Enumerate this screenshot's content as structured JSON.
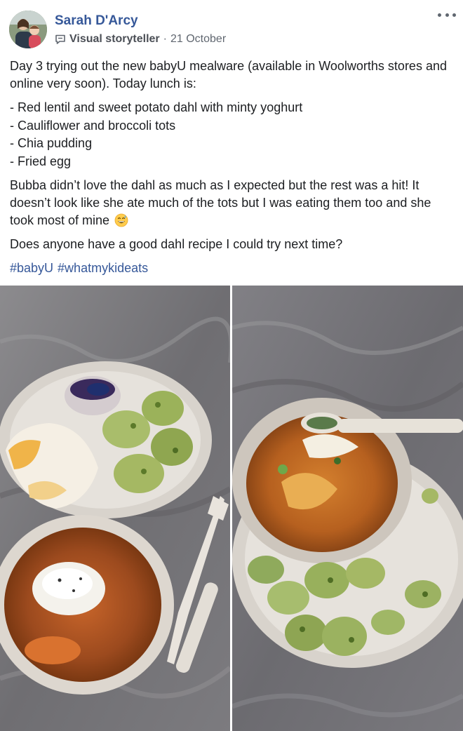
{
  "post": {
    "author": "Sarah D'Arcy",
    "badge": "Visual storyteller",
    "separator": "·",
    "date": "21 October",
    "intro": "Day 3 trying out the new babyU mealware (available in Woolworths stores and online very soon). Today lunch is:",
    "menu": [
      "- Red lentil and sweet potato dahl with minty yoghurt",
      "- Cauliflower and broccoli tots",
      "- Chia pudding",
      "- Fried egg"
    ],
    "review": "Bubba didn’t love the dahl as much as I expected but the rest was a hit! It doesn’t look like she ate much of the tots but I was eating them too and she took most of mine",
    "question": "Does anyone have a good dahl recipe I could try next time?",
    "hashtags": [
      "#babyU",
      "#whatmykideats"
    ]
  },
  "icons": {
    "avatar": "profile-photo",
    "badge": "speech-bubble-icon",
    "more": "ellipsis-icon",
    "emoji": "grinning-sweat-emoji"
  },
  "colors": {
    "link": "#365899",
    "meta": "#606770",
    "text": "#1c1e21"
  }
}
